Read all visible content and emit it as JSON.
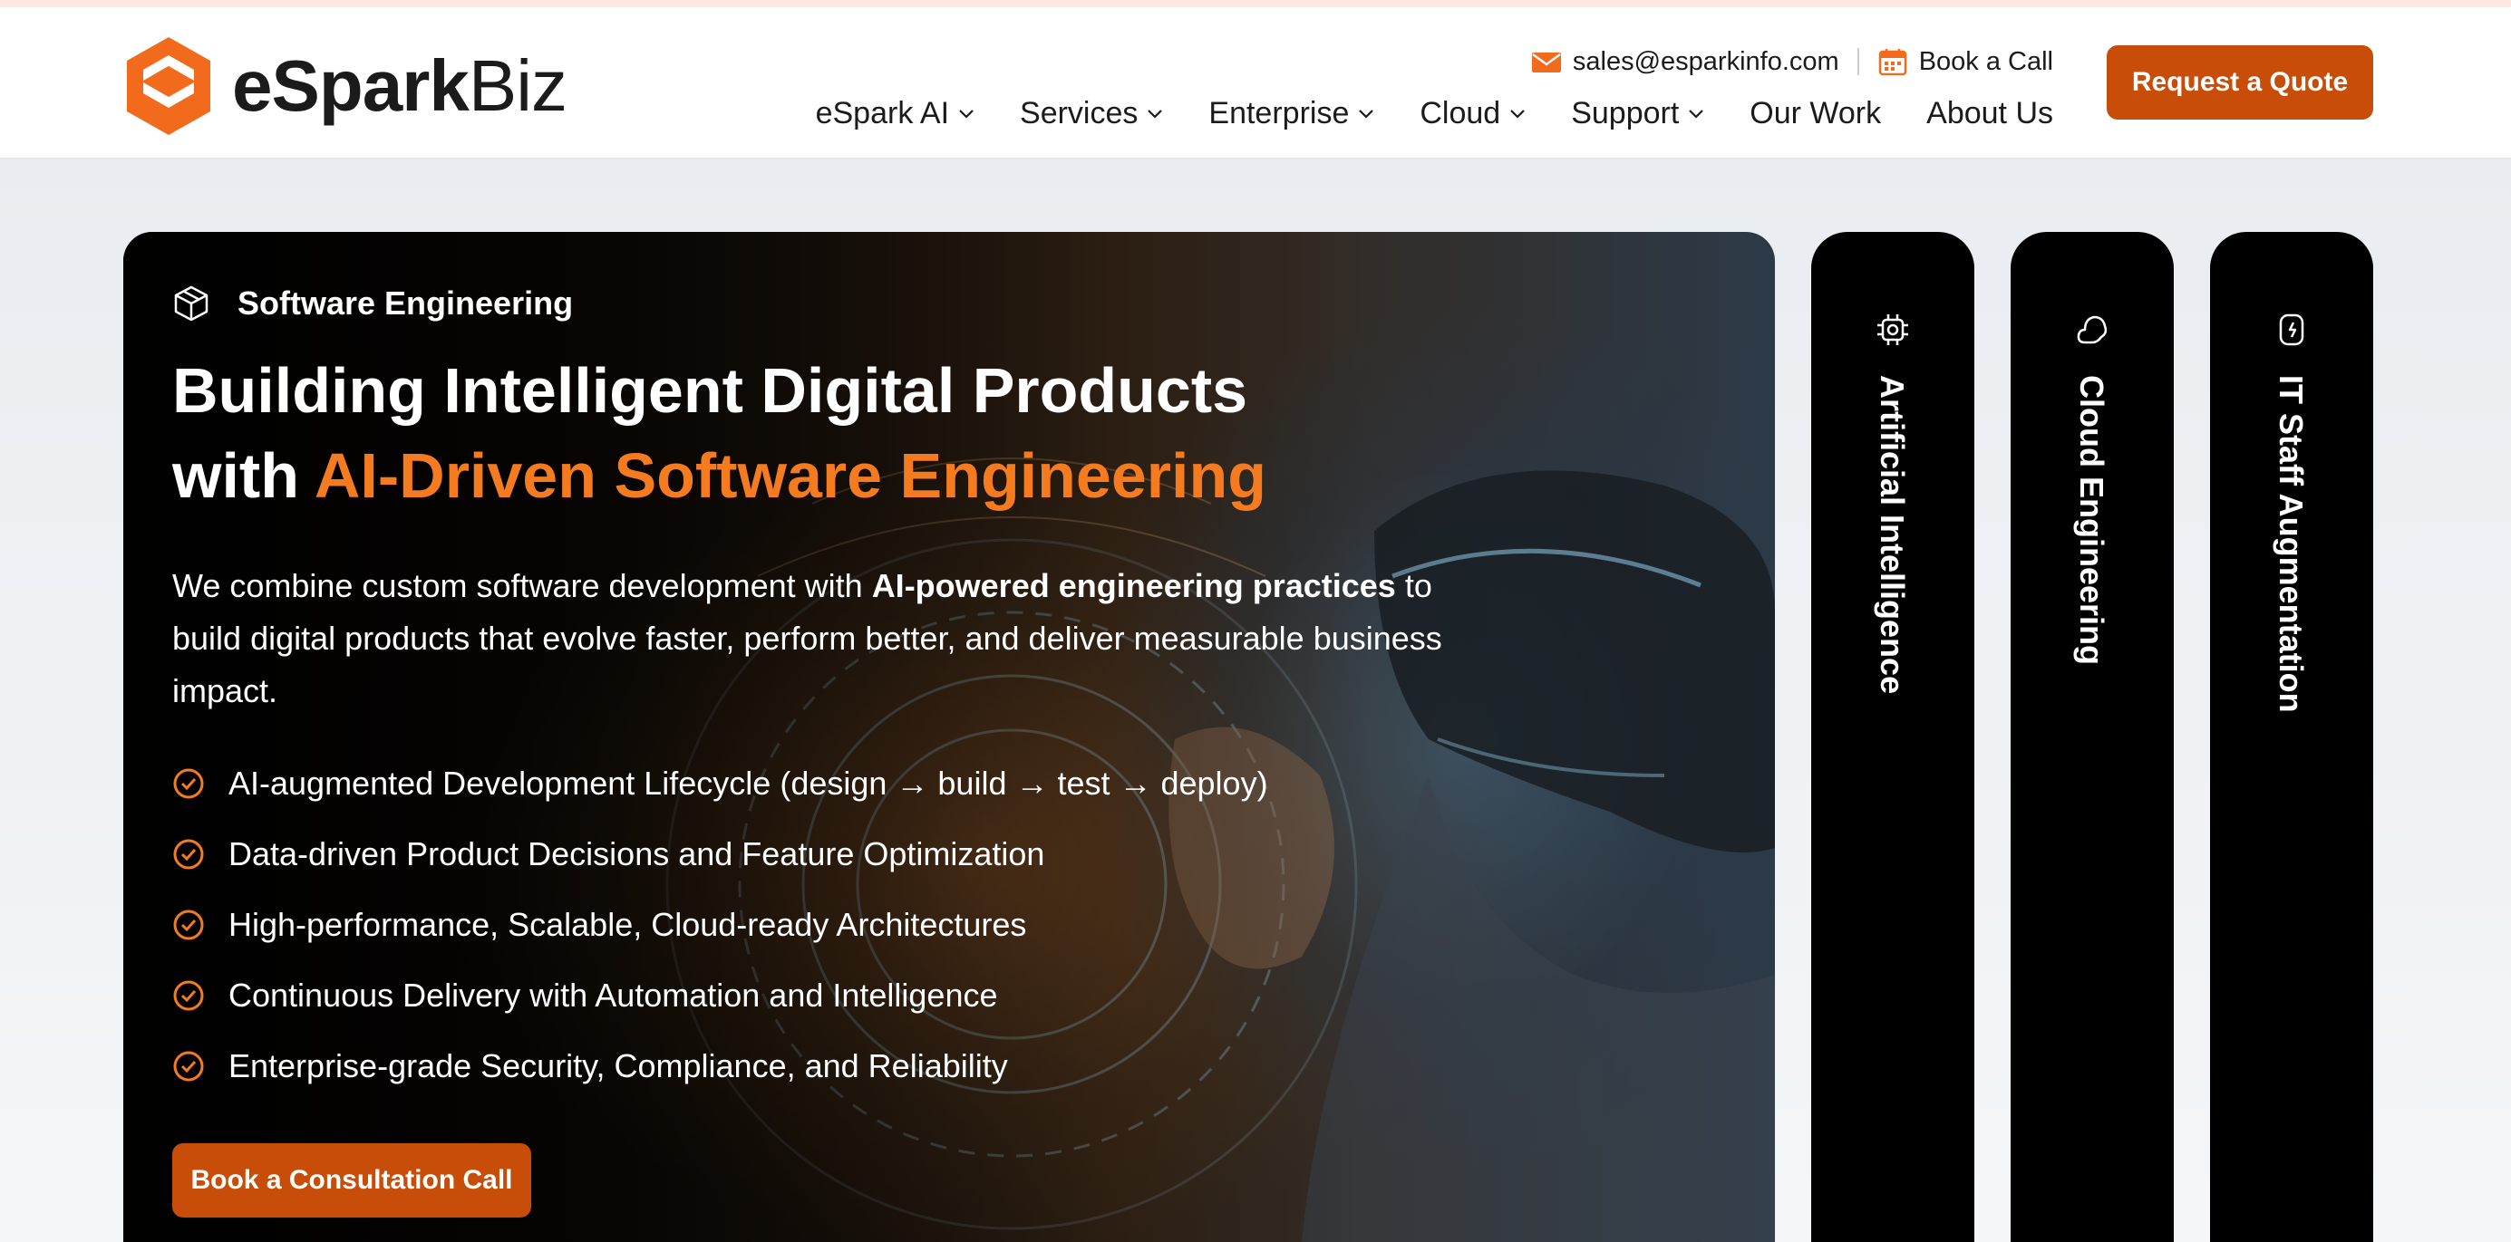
{
  "header": {
    "logo": {
      "brand_main": "eSpark",
      "brand_suffix": "Biz"
    },
    "contact": {
      "email": "sales@esparkinfo.com",
      "book_call": "Book a Call"
    },
    "nav": [
      {
        "label": "eSpark AI",
        "has_dropdown": true
      },
      {
        "label": "Services",
        "has_dropdown": true
      },
      {
        "label": "Enterprise",
        "has_dropdown": true
      },
      {
        "label": "Cloud",
        "has_dropdown": true
      },
      {
        "label": "Support",
        "has_dropdown": true
      },
      {
        "label": "Our Work",
        "has_dropdown": false
      },
      {
        "label": "About Us",
        "has_dropdown": false
      }
    ],
    "quote_button": "Request a Quote"
  },
  "hero": {
    "tag": "Software Engineering",
    "title_line1": "Building Intelligent Digital Products",
    "title_with": "with ",
    "title_accent": "AI-Driven Software Engineering",
    "desc_pre": "We combine custom software development with ",
    "desc_bold": "AI-powered engineering practices",
    "desc_post": " to build digital products that evolve faster, perform better, and deliver measurable business impact.",
    "bullets": [
      "AI-augmented Development Lifecycle (design → build → test → deploy)",
      "Data-driven Product Decisions and Feature Optimization",
      "High-performance, Scalable, Cloud-ready Architectures",
      "Continuous Delivery with Automation and Intelligence",
      "Enterprise-grade Security, Compliance, and Reliability"
    ],
    "cta": "Book a Consultation Call"
  },
  "side_tabs": [
    {
      "label": "Artificial Intelligence",
      "icon": "chip-icon"
    },
    {
      "label": "Cloud Engineering",
      "icon": "cloud-icon"
    },
    {
      "label": "IT Staff Augmentation",
      "icon": "person-icon"
    }
  ],
  "colors": {
    "accent": "#f47b20",
    "button": "#c84d08",
    "dark": "#000000"
  }
}
